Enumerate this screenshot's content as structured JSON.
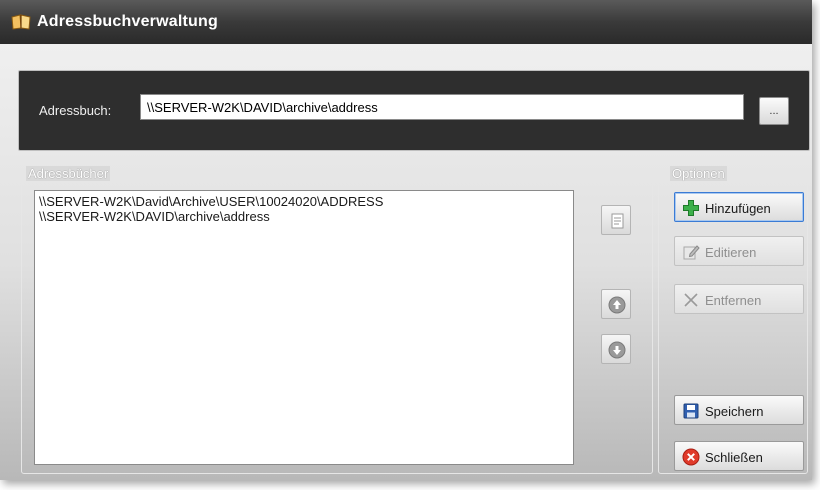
{
  "window": {
    "title": "Adressbuchverwaltung"
  },
  "path": {
    "label": "Adressbuch:",
    "value": "\\\\SERVER-W2K\\DAVID\\archive\\address",
    "browse_label": "..."
  },
  "addressbooks": {
    "group_label": "Adressbücher",
    "items": [
      "\\\\SERVER-W2K\\David\\Archive\\USER\\10024020\\ADDRESS",
      "\\\\SERVER-W2K\\DAVID\\archive\\address"
    ]
  },
  "options": {
    "group_label": "Optionen",
    "add_label": "Hinzufügen",
    "edit_label": "Editieren",
    "remove_label": "Entfernen",
    "save_label": "Speichern",
    "close_label": "Schließen"
  },
  "icons": {
    "title": "address-book-icon",
    "properties": "properties-icon",
    "up": "arrow-up-icon",
    "down": "arrow-down-icon",
    "add": "plus-icon",
    "edit": "pencil-icon",
    "remove": "x-icon",
    "save": "floppy-disk-icon",
    "close": "close-icon"
  },
  "colors": {
    "titlebar": "#3a3a3a",
    "add_icon": "#3cb04a",
    "close_icon": "#e03a2a",
    "save_icon": "#2f5fb0"
  }
}
